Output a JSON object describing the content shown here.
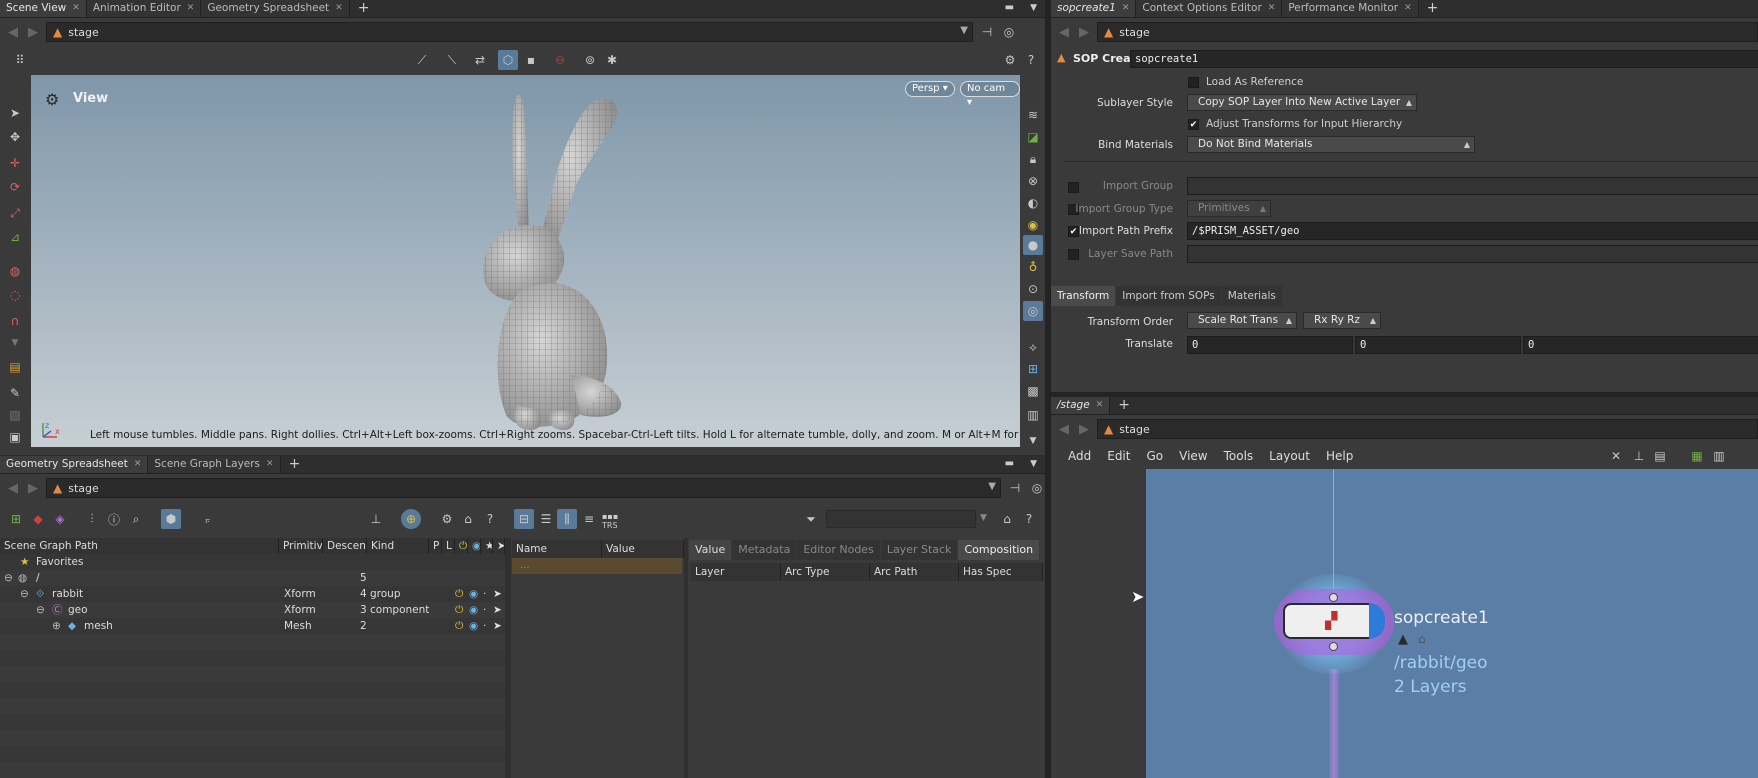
{
  "left_top": {
    "tabs": [
      {
        "label": "Scene View",
        "active": true
      },
      {
        "label": "Animation Editor",
        "active": false
      },
      {
        "label": "Geometry Spreadsheet",
        "active": false
      }
    ],
    "path": "stage",
    "view_label": "View",
    "persp_label": "Persp",
    "cam_label": "No cam",
    "hint": "Left mouse tumbles. Middle pans. Right dollies. Ctrl+Alt+Left box-zooms. Ctrl+Right zooms. Spacebar-Ctrl-Left tilts. Hold L for alternate tumble, dolly, and zoom. M or Alt+M for First Person Navigation.",
    "axis_x": "x",
    "axis_z": "z"
  },
  "left_bottom": {
    "tabs": [
      {
        "label": "Geometry Spreadsheet",
        "active": true
      },
      {
        "label": "Scene Graph Layers",
        "active": false
      }
    ],
    "path": "stage",
    "columns": [
      "Scene Graph Path",
      "Primitiv",
      "Descend",
      "Kind",
      "P",
      "L"
    ],
    "rows": [
      {
        "name": "Favorites",
        "prim": "",
        "desc": "",
        "kind": ""
      },
      {
        "name": "/",
        "prim": "",
        "desc": "5",
        "kind": ""
      },
      {
        "name": "rabbit",
        "prim": "Xform",
        "desc": "4",
        "kind": "group"
      },
      {
        "name": "geo",
        "prim": "Xform",
        "desc": "3",
        "kind": "component"
      },
      {
        "name": "mesh",
        "prim": "Mesh",
        "desc": "2",
        "kind": ""
      }
    ],
    "attr_columns": [
      "Name",
      "Value"
    ],
    "attr_row": "...",
    "trs_label": "TRS",
    "detail_tabs": [
      {
        "label": "Value",
        "active": false
      },
      {
        "label": "Metadata",
        "active": false
      },
      {
        "label": "Editor Nodes",
        "active": false
      },
      {
        "label": "Layer Stack",
        "active": false
      },
      {
        "label": "Composition",
        "active": true
      }
    ],
    "comp_columns": [
      "Layer",
      "Arc Type",
      "Arc Path",
      "Has Spec"
    ]
  },
  "right_top": {
    "tabs": [
      {
        "label": "sopcreate1",
        "active": true
      },
      {
        "label": "Context Options Editor",
        "active": false
      },
      {
        "label": "Performance Monitor",
        "active": false
      }
    ],
    "path": "stage",
    "node_type": "SOP Create",
    "node_name": "sopcreate1",
    "params": {
      "load_as_reference": "Load As Reference",
      "sublayer_style_label": "Sublayer Style",
      "sublayer_style_value": "Copy SOP Layer Into New Active Layer",
      "adjust_transforms": "Adjust Transforms for Input Hierarchy",
      "bind_materials_label": "Bind Materials",
      "bind_materials_value": "Do Not Bind Materials",
      "import_group_label": "Import Group",
      "import_group_type_label": "Import Group Type",
      "import_group_type_value": "Primitives",
      "import_path_prefix_label": "Import Path Prefix",
      "import_path_prefix_value": "/$PRISM_ASSET/geo",
      "layer_save_path_label": "Layer Save Path"
    },
    "sub_tabs": [
      {
        "label": "Transform",
        "active": true
      },
      {
        "label": "Import from SOPs",
        "active": false
      },
      {
        "label": "Materials",
        "active": false
      }
    ],
    "transform_order_label": "Transform Order",
    "transform_order_value": "Scale Rot Trans",
    "rot_order_value": "Rx Ry Rz",
    "translate_label": "Translate",
    "translate_values": [
      "0",
      "0",
      "0"
    ]
  },
  "right_bottom": {
    "tabs": [
      {
        "label": "/stage",
        "active": true
      }
    ],
    "path": "stage",
    "menu": [
      "Add",
      "Edit",
      "Go",
      "View",
      "Tools",
      "Layout",
      "Help"
    ],
    "node_label": "sopcreate1",
    "node_path": "/rabbit/geo",
    "node_layers": "2 Layers"
  },
  "colors": {
    "accent_orange": "#e58a3a",
    "network_bg": "#5b7ea6",
    "viewport_top": "#7f97aa",
    "viewport_bottom": "#c7cfd4"
  }
}
